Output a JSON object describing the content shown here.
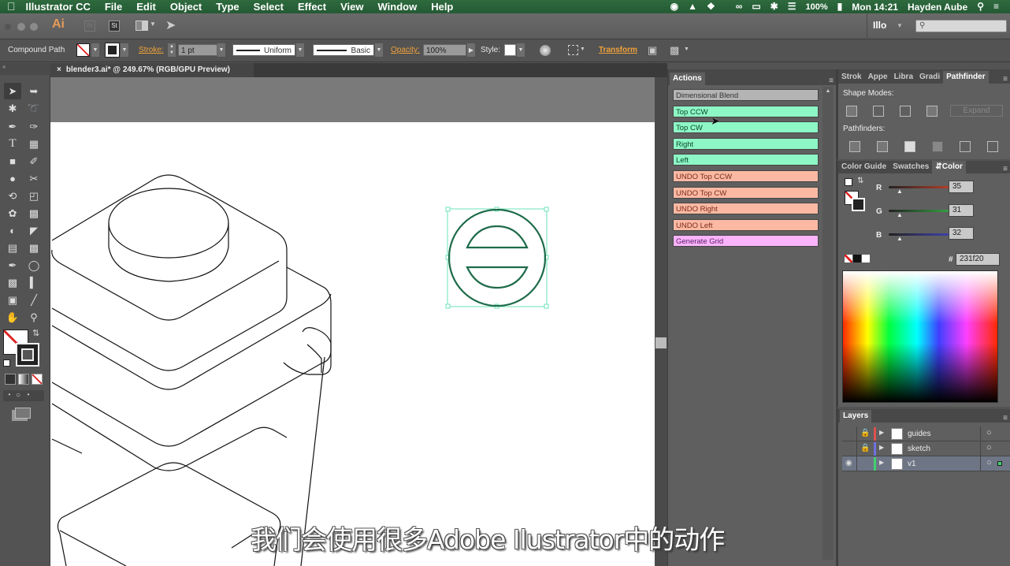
{
  "menubar": {
    "app_name": "Illustrator CC",
    "items": [
      "File",
      "Edit",
      "Object",
      "Type",
      "Select",
      "Effect",
      "View",
      "Window",
      "Help"
    ],
    "battery": "100%",
    "clock": "Mon 14:21",
    "user": "Hayden Aube",
    "status_icons": [
      "record-icon",
      "google-drive-icon",
      "dropbox-icon",
      "creative-cloud-icon",
      "airplay-icon",
      "bluetooth-icon",
      "wifi-icon",
      "battery-icon",
      "spotlight-icon",
      "notification-center-icon"
    ]
  },
  "appbar": {
    "logo": "Ai",
    "bridge": "Br",
    "stock": "St",
    "workspace": "Illo",
    "search_placeholder": ""
  },
  "control_bar": {
    "selection_type": "Compound Path",
    "stroke_label": "Stroke:",
    "stroke_weight": "1 pt",
    "profile": "Uniform",
    "brush": "Basic",
    "opacity_label": "Opacity:",
    "opacity": "100%",
    "style_label": "Style:",
    "transform_label": "Transform"
  },
  "document": {
    "tab_title": "blender3.ai* @ 249.67% (RGB/GPU Preview)",
    "zoom": "249.67%",
    "color_mode": "RGB/GPU Preview"
  },
  "actions_panel": {
    "title": "Actions",
    "items": [
      {
        "label": "Dimensional Blend",
        "color": "#b4b4b4"
      },
      {
        "label": "Top CCW",
        "color": "#8ef7c6"
      },
      {
        "label": "Top CW",
        "color": "#8ef7c6"
      },
      {
        "label": "Right",
        "color": "#8ef7c6"
      },
      {
        "label": "Left",
        "color": "#8ef7c6"
      },
      {
        "label": "UNDO Top CCW",
        "color": "#fbb9a3"
      },
      {
        "label": "UNDO Top CW",
        "color": "#fbb9a3"
      },
      {
        "label": "UNDO Right",
        "color": "#fbb9a3"
      },
      {
        "label": "UNDO Left",
        "color": "#fbb9a3"
      },
      {
        "label": "Generate Grid",
        "color": "#fbb4fb"
      }
    ]
  },
  "pathfinder_panel": {
    "tabs": [
      "Strok",
      "Appe",
      "Libra",
      "Gradi",
      "Pathfinder"
    ],
    "active_tab": "Pathfinder",
    "shape_modes_label": "Shape Modes:",
    "expand_label": "Expand",
    "pathfinders_label": "Pathfinders:"
  },
  "color_panel": {
    "tabs": [
      "Color Guide",
      "Swatches",
      "Color"
    ],
    "active_tab": "Color",
    "channels": [
      {
        "label": "R",
        "value": "35",
        "color": "#e0452a"
      },
      {
        "label": "G",
        "value": "31",
        "color": "#39c64a"
      },
      {
        "label": "B",
        "value": "32",
        "color": "#4a4ad6"
      }
    ],
    "hex_label": "#",
    "hex": "231f20"
  },
  "layers_panel": {
    "title": "Layers",
    "layers": [
      {
        "name": "guides",
        "color": "#e05050",
        "locked": true,
        "visible": false,
        "selected": false
      },
      {
        "name": "sketch",
        "color": "#7070e0",
        "locked": true,
        "visible": false,
        "selected": false
      },
      {
        "name": "v1",
        "color": "#40d070",
        "locked": false,
        "visible": true,
        "selected": true
      }
    ]
  },
  "subtitle": "我们会使用很多Adobe Ilustrator中的动作"
}
